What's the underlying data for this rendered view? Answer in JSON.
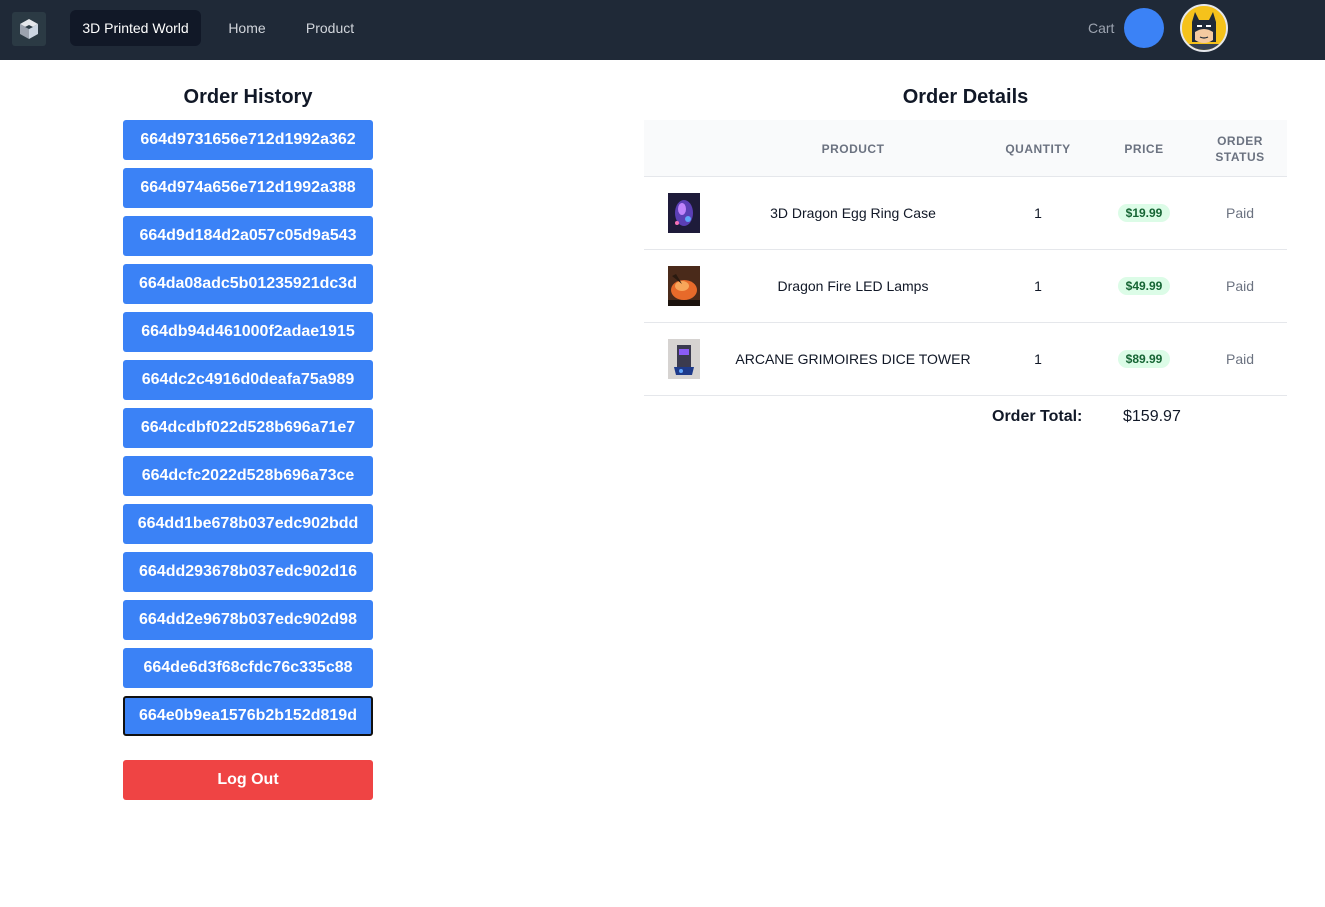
{
  "nav": {
    "logo_icon": "cube-logo-icon",
    "brand": "3D Printed World",
    "links": [
      "Home",
      "Product"
    ],
    "cart_label": "Cart",
    "cart_color": "#3b82f6",
    "avatar_icon": "batman-avatar-icon"
  },
  "history": {
    "title": "Order History",
    "orders": [
      "664d9731656e712d1992a362",
      "664d974a656e712d1992a388",
      "664d9d184d2a057c05d9a543",
      "664da08adc5b01235921dc3d",
      "664db94d461000f2adae1915",
      "664dc2c4916d0deafa75a989",
      "664dcdbf022d528b696a71e7",
      "664dcfc2022d528b696a73ce",
      "664dd1be678b037edc902bdd",
      "664dd293678b037edc902d16",
      "664dd2e9678b037edc902d98",
      "664de6d3f68cfdc76c335c88",
      "664e0b9ea1576b2b152d819d"
    ],
    "selected_order": "664e0b9ea1576b2b152d819d",
    "logout_label": "Log Out"
  },
  "details": {
    "title": "Order Details",
    "headers": {
      "product": "PRODUCT",
      "quantity": "QUANTITY",
      "price": "PRICE",
      "status": "ORDER STATUS"
    },
    "items": [
      {
        "name": "3D Dragon Egg Ring Case",
        "quantity": "1",
        "price": "$19.99",
        "status": "Paid",
        "thumb_icon": "dragon-egg-thumbnail"
      },
      {
        "name": "Dragon Fire LED Lamps",
        "quantity": "1",
        "price": "$49.99",
        "status": "Paid",
        "thumb_icon": "dragon-lamp-thumbnail"
      },
      {
        "name": "ARCANE GRIMOIRES DICE TOWER",
        "quantity": "1",
        "price": "$89.99",
        "status": "Paid",
        "thumb_icon": "dice-tower-thumbnail"
      }
    ],
    "total_label": "Order Total:",
    "total_value": "$159.97"
  },
  "colors": {
    "nav_bg": "#1f2937",
    "primary": "#3b82f6",
    "danger": "#ef4444",
    "price_pill_bg": "#dcfce7",
    "price_pill_text": "#166534"
  }
}
